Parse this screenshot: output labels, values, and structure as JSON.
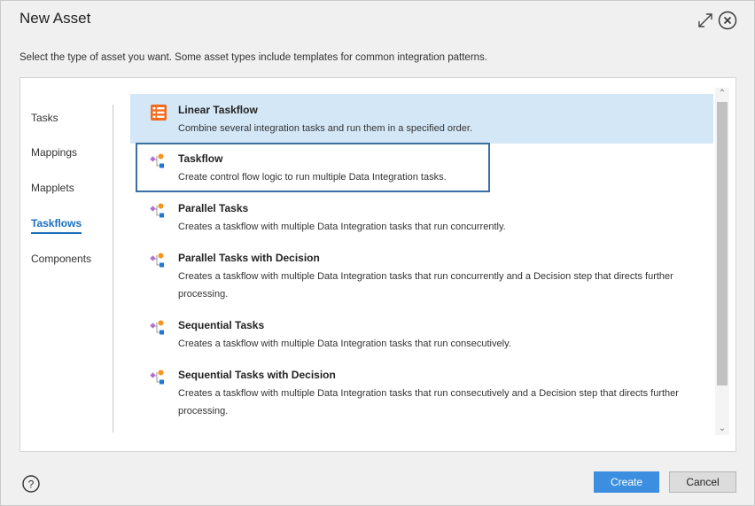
{
  "dialog": {
    "title": "New Asset",
    "subtitle": "Select the type of asset you want. Some asset types include templates for common integration patterns."
  },
  "nav": {
    "items": [
      {
        "label": "Tasks"
      },
      {
        "label": "Mappings"
      },
      {
        "label": "Mapplets"
      },
      {
        "label": "Taskflows",
        "active": true
      },
      {
        "label": "Components"
      }
    ]
  },
  "assets": [
    {
      "name": "Linear Taskflow",
      "description": "Combine several integration tasks and run them in a specified order.",
      "icon": "linear-taskflow-icon",
      "selected": true
    },
    {
      "name": "Taskflow",
      "description": "Create control flow logic to run multiple Data Integration tasks.",
      "icon": "taskflow-icon",
      "focused": true
    },
    {
      "name": "Parallel Tasks",
      "description": "Creates a taskflow with multiple Data Integration tasks that run concurrently.",
      "icon": "taskflow-icon"
    },
    {
      "name": "Parallel Tasks with Decision",
      "description": "Creates a taskflow with multiple Data Integration tasks that run concurrently and a Decision step that directs further processing.",
      "icon": "taskflow-icon"
    },
    {
      "name": "Sequential Tasks",
      "description": "Creates a taskflow with multiple Data Integration tasks that run consecutively.",
      "icon": "taskflow-icon"
    },
    {
      "name": "Sequential Tasks with Decision",
      "description": "Creates a taskflow with multiple Data Integration tasks that run consecutively and a Decision step that directs further processing.",
      "icon": "taskflow-icon"
    }
  ],
  "buttons": {
    "create": "Create",
    "cancel": "Cancel"
  },
  "colors": {
    "accent": "#3c8fe0",
    "selected_row": "#d4e7f7",
    "active_nav": "#1a6fbf",
    "focus_border": "#3a6fa3"
  }
}
